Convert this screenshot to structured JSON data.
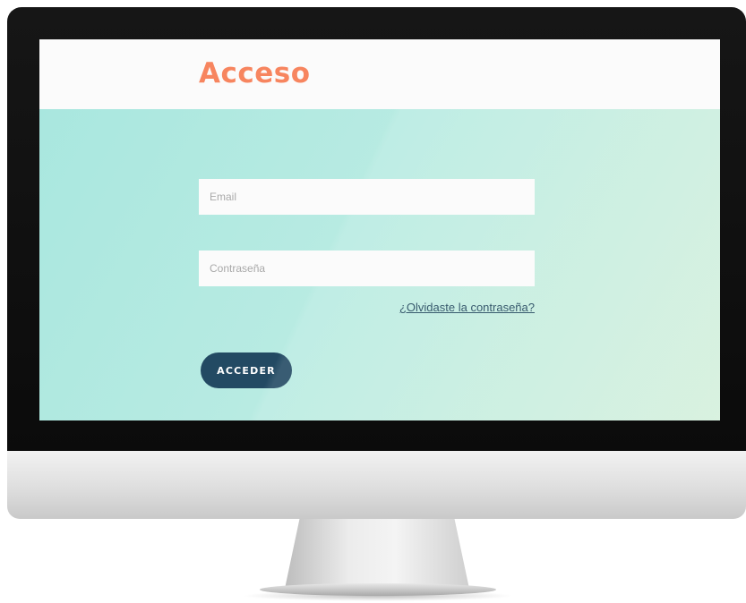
{
  "header": {
    "title": "Acceso"
  },
  "form": {
    "email": {
      "placeholder": "Email",
      "value": ""
    },
    "password": {
      "placeholder": "Contraseña",
      "value": ""
    },
    "forgot_link": "¿Olvidaste la contraseña?",
    "submit_label": "ACCEDER"
  },
  "colors": {
    "accent": "#f7855f",
    "button": "#234a63",
    "link": "#22485e",
    "background_start": "#a9e7df",
    "background_end": "#d5f0dd"
  }
}
